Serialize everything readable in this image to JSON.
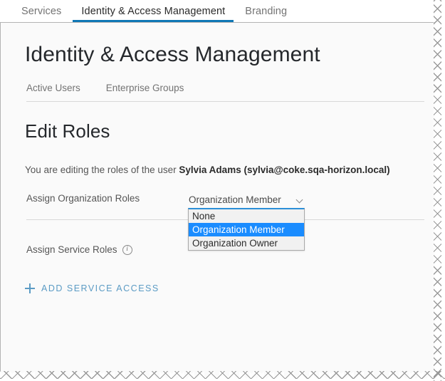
{
  "colors": {
    "accent": "#0f77b5",
    "option_highlight": "#1a8cff",
    "link": "#5b9bc4",
    "dropdown_top_border": "#2b8fd8"
  },
  "tabbar": {
    "tabs": [
      {
        "label": "Services",
        "active": false
      },
      {
        "label": "Identity & Access Management",
        "active": true
      },
      {
        "label": "Branding",
        "active": false
      }
    ]
  },
  "page": {
    "title": "Identity & Access Management",
    "subnav": [
      {
        "label": "Active Users"
      },
      {
        "label": "Enterprise Groups"
      }
    ],
    "section_title": "Edit Roles",
    "description": {
      "prefix": "You are editing the roles of the user ",
      "user": "Sylvia Adams (sylvia@coke.sqa-horizon.local)"
    }
  },
  "org_roles": {
    "label": "Assign Organization Roles",
    "selected": "Organization Member",
    "chevron_icon": "chevron-down-icon",
    "options": [
      {
        "label": "None",
        "selected": false
      },
      {
        "label": "Organization Member",
        "selected": true
      },
      {
        "label": "Organization Owner",
        "selected": false
      }
    ]
  },
  "service_roles": {
    "label": "Assign Service Roles",
    "info_icon": "info-circle-icon",
    "info_glyph": "i"
  },
  "add_service_access": {
    "label": "Add Service Access",
    "plus_icon": "plus-icon"
  }
}
